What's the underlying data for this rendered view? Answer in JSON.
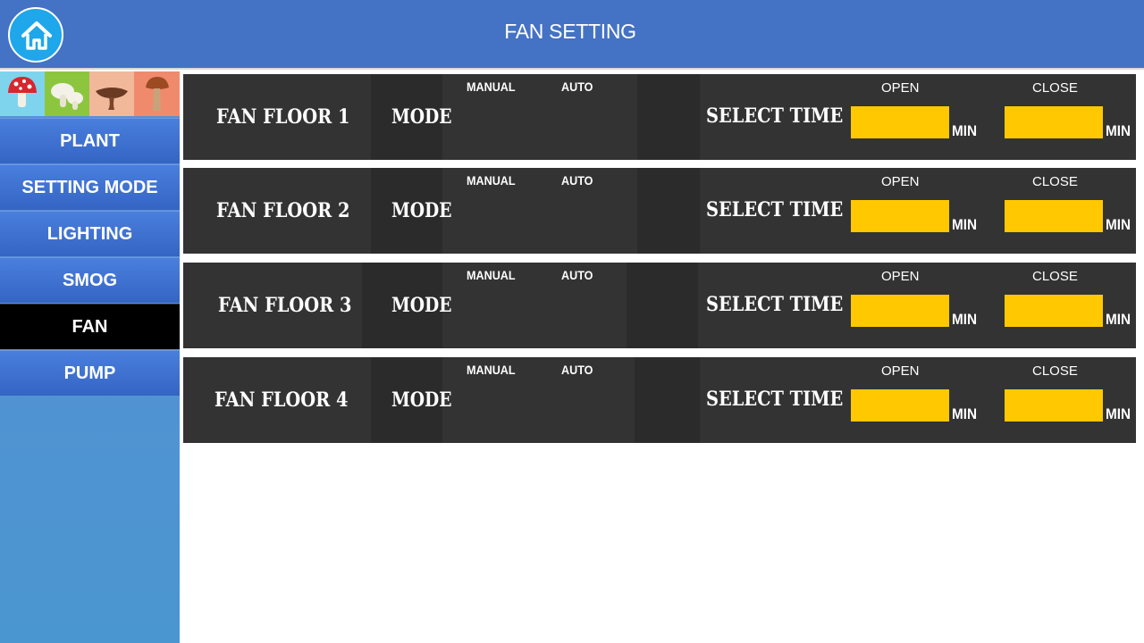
{
  "header": {
    "title": "FAN SETTING",
    "home_icon": "home-icon"
  },
  "sidebar": {
    "icons": [
      "red-mushroom-icon",
      "white-mushroom-icon",
      "brown-mushroom-icon",
      "tall-mushroom-icon"
    ],
    "items": [
      {
        "label": "PLANT",
        "active": false
      },
      {
        "label": "SETTING MODE",
        "active": false
      },
      {
        "label": "LIGHTING",
        "active": false
      },
      {
        "label": "SMOG",
        "active": false
      },
      {
        "label": "FAN",
        "active": true
      },
      {
        "label": "PUMP",
        "active": false
      }
    ]
  },
  "rows": [
    {
      "label": "FAN FLOOR 1",
      "mode": "MODE",
      "manual": "MANUAL",
      "auto": "AUTO",
      "select_time": "SELECT TIME",
      "open_label": "OPEN",
      "close_label": "CLOSE",
      "open_value": "",
      "close_value": "",
      "unit": "MIN"
    },
    {
      "label": "FAN FLOOR 2",
      "mode": "MODE",
      "manual": "MANUAL",
      "auto": "AUTO",
      "select_time": "SELECT TIME",
      "open_label": "OPEN",
      "close_label": "CLOSE",
      "open_value": "",
      "close_value": "",
      "unit": "MIN"
    },
    {
      "label": "FAN FLOOR 3",
      "mode": "MODE",
      "manual": "MANUAL",
      "auto": "AUTO",
      "select_time": "SELECT TIME",
      "open_label": "OPEN",
      "close_label": "CLOSE",
      "open_value": "",
      "close_value": "",
      "unit": "MIN"
    },
    {
      "label": "FAN FLOOR 4",
      "mode": "MODE",
      "manual": "MANUAL",
      "auto": "AUTO",
      "select_time": "SELECT TIME",
      "open_label": "OPEN",
      "close_label": "CLOSE",
      "open_value": "",
      "close_value": "",
      "unit": "MIN"
    }
  ],
  "colors": {
    "header": "#4472c4",
    "nav": "#3d6fce",
    "nav_active": "#000000",
    "row": "#333333",
    "time_box": "#ffc800"
  }
}
